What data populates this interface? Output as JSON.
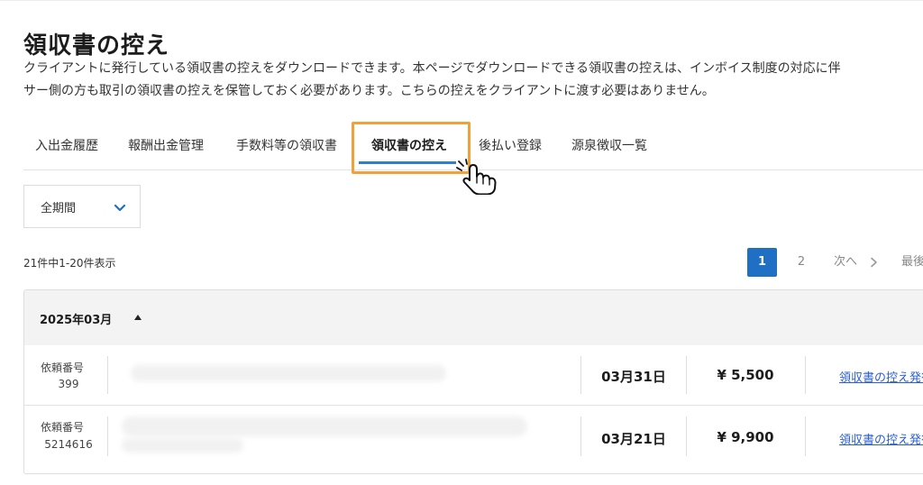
{
  "header": {
    "title": "領収書の控え",
    "description": [
      "クライアントに発行している領収書の控えをダウンロードできます。本ページでダウンロードできる領収書の控えは、インボイス制度の対応に伴",
      "サー側の方も取引の領収書の控えを保管しておく必要があります。こちらの控えをクライアントに渡す必要はありません。"
    ]
  },
  "tabs": [
    {
      "label": "入出金履歴",
      "active": false
    },
    {
      "label": "報酬出金管理",
      "active": false
    },
    {
      "label": "手数料等の領収書",
      "active": false
    },
    {
      "label": "領収書の控え",
      "active": true
    },
    {
      "label": "後払い登録",
      "active": false
    },
    {
      "label": "源泉徴収一覧",
      "active": false
    }
  ],
  "filter": {
    "period_value": "全期間",
    "icon": "chevron-down-icon"
  },
  "pagination": {
    "summary": "21件中1-20件表示",
    "current_page": "1",
    "other_page": "2",
    "next_label": "次へ",
    "last_label": "最後"
  },
  "group": {
    "label": "2025年03月",
    "toggle_icon": "caret-up-icon"
  },
  "rows": [
    {
      "request_label": "依頼番号",
      "request_number": "399",
      "date": "03月31日",
      "amount": "¥ 5,500",
      "link_label": "領収書の控え発行"
    },
    {
      "request_label": "依頼番号",
      "request_number": "5214616",
      "date": "03月21日",
      "amount": "¥ 9,900",
      "link_label": "領収書の控え発行"
    }
  ],
  "colors": {
    "accent": "#1f6fc5",
    "tab_underline": "#2f7fcf",
    "highlight": "#f0a23a",
    "link": "#2a5fd1"
  }
}
